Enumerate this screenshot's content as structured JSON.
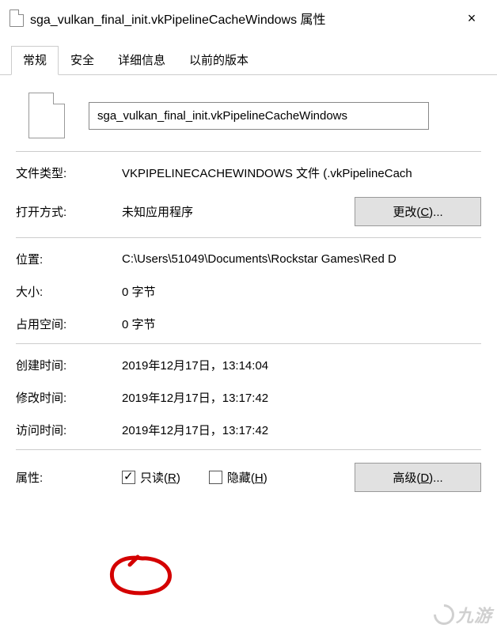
{
  "window": {
    "title": "sga_vulkan_final_init.vkPipelineCacheWindows 属性",
    "close": "×"
  },
  "tabs": {
    "t0": "常规",
    "t1": "安全",
    "t2": "详细信息",
    "t3": "以前的版本"
  },
  "file": {
    "name": "sga_vulkan_final_init.vkPipelineCacheWindows"
  },
  "labels": {
    "type": "文件类型:",
    "opens": "打开方式:",
    "location": "位置:",
    "size": "大小:",
    "disk": "占用空间:",
    "created": "创建时间:",
    "modified": "修改时间:",
    "accessed": "访问时间:",
    "attributes": "属性:"
  },
  "values": {
    "type": "VKPIPELINECACHEWINDOWS 文件 (.vkPipelineCach",
    "opens": "未知应用程序",
    "location": "C:\\Users\\51049\\Documents\\Rockstar Games\\Red D",
    "size": "0 字节",
    "disk": "0 字节",
    "created": "2019年12月17日，13:14:04",
    "modified": "2019年12月17日，13:17:42",
    "accessed": "2019年12月17日，13:17:42"
  },
  "buttons": {
    "change": "更改(C)...",
    "advanced": "高级(D)..."
  },
  "checks": {
    "readonly": "只读(R)",
    "hidden": "隐藏(H)"
  },
  "watermark": "九游"
}
